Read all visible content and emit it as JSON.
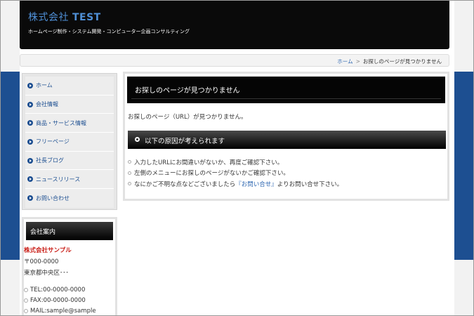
{
  "header": {
    "site_title_prefix": "株式会社",
    "site_title_bold": "TEST",
    "site_description": "ホームページ制作・システム開発・コンピューター企画コンサルティング"
  },
  "breadcrumb": {
    "home": "ホーム",
    "separator": ">",
    "current": "お探しのページが見つかりません"
  },
  "sidebar": {
    "items": [
      {
        "label": "ホーム"
      },
      {
        "label": "会社情報"
      },
      {
        "label": "商品・サービス情報"
      },
      {
        "label": "フリーページ"
      },
      {
        "label": "社長ブログ"
      },
      {
        "label": "ニュースリリース"
      },
      {
        "label": "お問い合わせ"
      }
    ]
  },
  "company": {
    "heading": "会社案内",
    "name": "株式会社サンプル",
    "postal": "〒000-0000",
    "address": "東京都中央区･･･",
    "tel": "TEL:00-0000-0000",
    "fax": "FAX:00-0000-0000",
    "mail": "MAIL:sample@sample"
  },
  "main": {
    "title": "お探しのページが見つかりません",
    "message": "お探しのページ（URL）が見つかりません。",
    "reasons_heading": "以下の原因が考えられます",
    "reasons": {
      "r1": "入力したURLにお間違いがないか、再度ご確認下さい。",
      "r2": "左側のメニューにお探しのページがないかご確認下さい。",
      "r3_before": "なにかご不明な点などございましたら",
      "r3_link": "『お問い合せ』",
      "r3_after": "よりお問い合せ下さい。"
    }
  },
  "colors": {
    "accent_blue": "#1d4f91",
    "link_blue": "#2a64b0",
    "company_red": "#c91d16",
    "header_black": "#0a0a0a"
  },
  "icons": {
    "nav_bullet": "circle-arrow-right-icon",
    "list_bullet": "ring-bullet-icon"
  }
}
